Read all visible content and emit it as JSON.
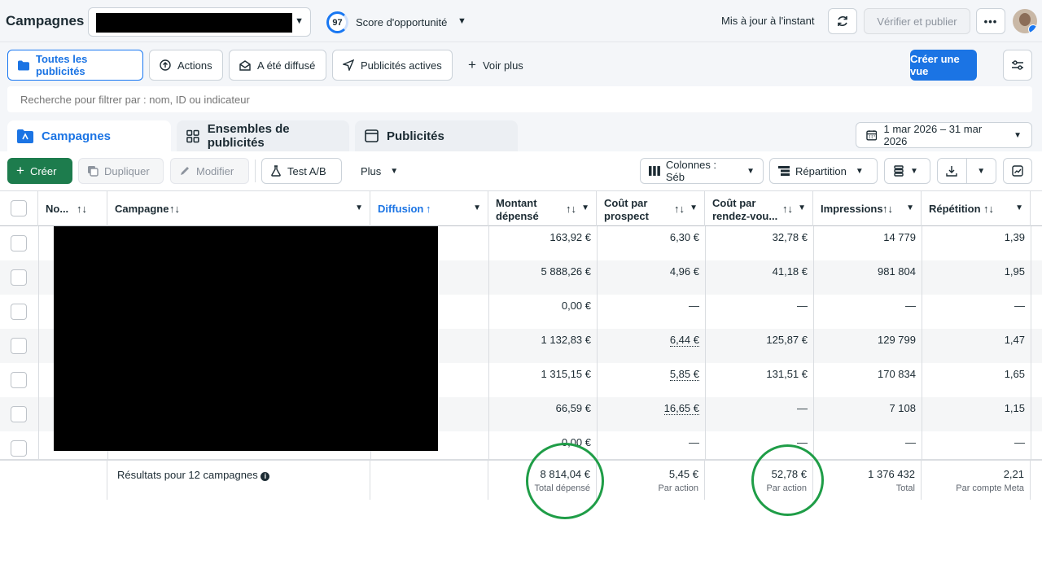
{
  "header": {
    "title": "Campagnes",
    "score_value": "97",
    "score_label": "Score d'opportunité",
    "update_status": "Mis à jour à l'instant",
    "publish_label": "Vérifier et publier",
    "more_label": "•••"
  },
  "filters": {
    "items": [
      "Toutes les publicités",
      "Actions",
      "A été diffusé",
      "Publicités actives"
    ],
    "see_more": "Voir plus",
    "create_view": "Créer une vue"
  },
  "search": {
    "placeholder": "Recherche pour filtrer par : nom, ID ou indicateur"
  },
  "tabs": [
    "Campagnes",
    "Ensembles de publicités",
    "Publicités"
  ],
  "date_range": "1 mar 2026 – 31 mar 2026",
  "toolbar": {
    "create": "Créer",
    "duplicate": "Dupliquer",
    "edit": "Modifier",
    "ab_test": "Test A/B",
    "more": "Plus",
    "columns": "Colonnes : Séb",
    "breakdown": "Répartition"
  },
  "columns": {
    "name": "No...",
    "campaign": "Campagne",
    "delivery": "Diffusion",
    "spent_1": "Montant",
    "spent_2": "dépensé",
    "cpl_1": "Coût par",
    "cpl_2": "prospect",
    "cpa_1": "Coût par",
    "cpa_2": "rendez-vou...",
    "impressions": "Impressions",
    "frequency": "Répétition"
  },
  "rows": [
    {
      "spent": "163,92 €",
      "cpl": "6,30 €",
      "cpa": "32,78 €",
      "impressions": "14 779",
      "frequency": "1,39"
    },
    {
      "spent": "5 888,26 €",
      "cpl": "4,96 €",
      "cpa": "41,18 €",
      "impressions": "981 804",
      "frequency": "1,95"
    },
    {
      "spent": "0,00 €",
      "cpl": "—",
      "cpa": "—",
      "impressions": "—",
      "frequency": "—"
    },
    {
      "spent": "1 132,83 €",
      "cpl": "6,44 €",
      "cpa": "125,87 €",
      "impressions": "129 799",
      "frequency": "1,47"
    },
    {
      "spent": "1 315,15 €",
      "cpl": "5,85 €",
      "cpa": "131,51 €",
      "impressions": "170 834",
      "frequency": "1,65"
    },
    {
      "spent": "66,59 €",
      "cpl": "16,65 €",
      "cpa": "—",
      "impressions": "7 108",
      "frequency": "1,15"
    },
    {
      "spent": "0,00 €",
      "cpl": "—",
      "cpa": "—",
      "impressions": "—",
      "frequency": "—"
    }
  ],
  "totals": {
    "label": "Résultats pour 12 campagnes",
    "spent": "8 814,04 €",
    "spent_sub": "Total dépensé",
    "cpl": "5,45 €",
    "cpl_sub": "Par action",
    "cpa": "52,78 €",
    "cpa_sub": "Par action",
    "impressions": "1 376 432",
    "impressions_sub": "Total",
    "frequency": "2,21",
    "frequency_sub": "Par compte Meta"
  },
  "colors": {
    "accent": "#1b74e4",
    "create": "#1d7c4d",
    "highlight": "#1f9d47"
  }
}
